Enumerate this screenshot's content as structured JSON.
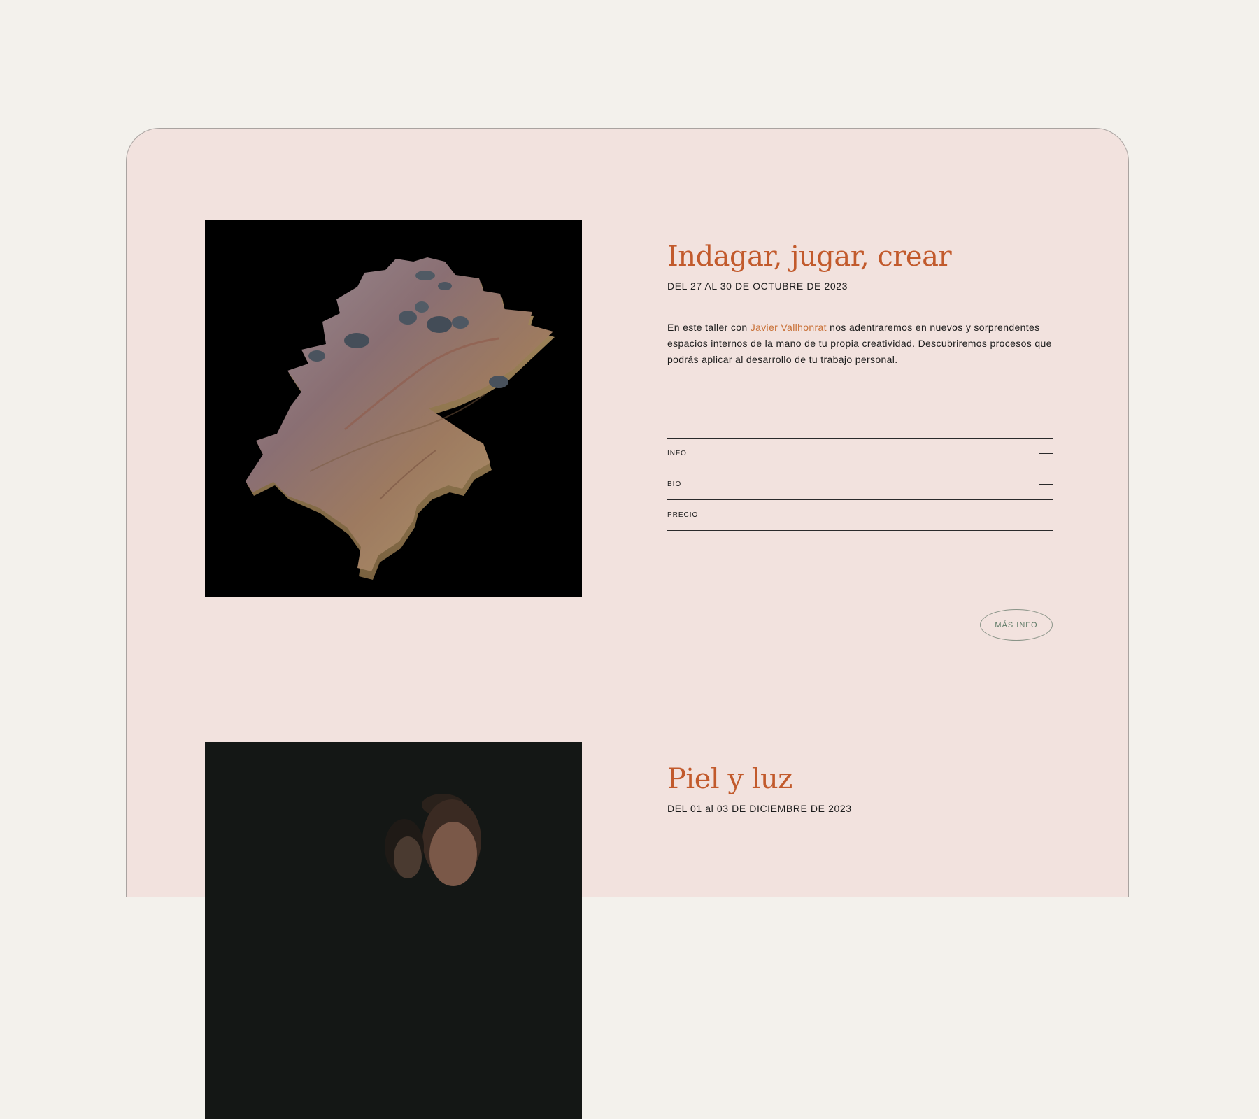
{
  "colors": {
    "page_background": "#f3f1ec",
    "card_background": "#f2e2de",
    "accent": "#c25a2c",
    "link": "#c87036",
    "button_text": "#5e7a66"
  },
  "workshops": [
    {
      "title": "Indagar, jugar, crear",
      "date": "DEL 27 AL 30 DE OCTUBRE DE 2023",
      "description_before": "En este taller con ",
      "description_link": "Javier Vallhonrat",
      "description_after": " nos adentraremos en nuevos y sorprendentes espacios internos de la mano de tu propia creatividad. Descubriremos procesos que podrás aplicar al desarrollo de tu trabajo personal.",
      "accordion": [
        {
          "label": "INFO",
          "icon": "plus-icon"
        },
        {
          "label": "BIO",
          "icon": "plus-icon"
        },
        {
          "label": "PRECIO",
          "icon": "plus-icon"
        }
      ],
      "button_label": "MÁS INFO"
    },
    {
      "title": "Piel y luz",
      "date": "DEL 01 al 03 DE DICIEMBRE DE 2023"
    }
  ]
}
